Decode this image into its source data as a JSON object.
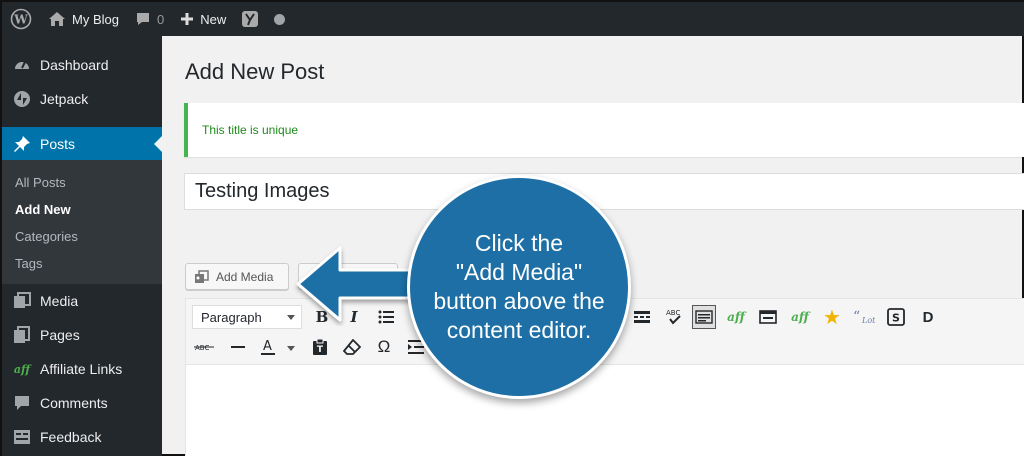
{
  "adminbar": {
    "site_name": "My Blog",
    "comments_count": "0",
    "new_label": "New",
    "icons": [
      "wordpress-logo",
      "home",
      "comment-bubble",
      "plus",
      "yoast-y",
      "status-dot"
    ]
  },
  "sidebar": {
    "items": [
      {
        "label": "Dashboard",
        "icon": "dashboard"
      },
      {
        "label": "Jetpack",
        "icon": "jetpack"
      },
      {
        "label": "Posts",
        "icon": "pushpin",
        "current": true
      },
      {
        "label": "Media",
        "icon": "media"
      },
      {
        "label": "Pages",
        "icon": "pages"
      },
      {
        "label": "Affiliate Links",
        "icon": "aff"
      },
      {
        "label": "Comments",
        "icon": "comment-bubble"
      },
      {
        "label": "Feedback",
        "icon": "feedback"
      }
    ],
    "submenu": [
      "All Posts",
      "Add New",
      "Categories",
      "Tags"
    ],
    "submenu_current": "Add New"
  },
  "main": {
    "page_title": "Add New Post",
    "notice": "This title is unique",
    "post_title": "Testing Images",
    "add_media_label": "Add Media"
  },
  "toolbar": {
    "format_select": "Paragraph",
    "aff_label": "aff",
    "icons_row1": [
      "bold",
      "italic",
      "bulleted-list",
      "more-tag",
      "spellcheck",
      "toolbar-toggle",
      "aff-link",
      "form",
      "aff-add",
      "star",
      "quote-lot",
      "s-box",
      "d"
    ],
    "icons_row2": [
      "strikethrough",
      "horizontal-line",
      "text-color",
      "paste-text",
      "clear-formatting",
      "special-character",
      "indent"
    ]
  },
  "callout": {
    "lines": [
      "Click the",
      "\"Add Media\"",
      "button above the",
      "content editor."
    ],
    "color": "#1d6fa5"
  }
}
